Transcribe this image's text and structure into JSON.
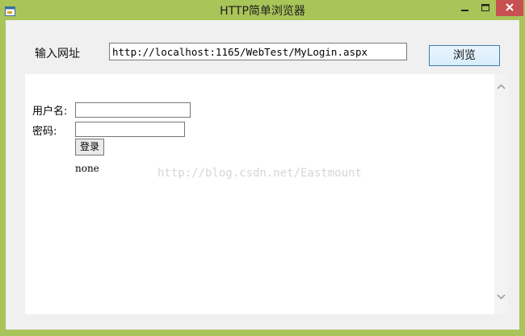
{
  "window": {
    "title": "HTTP简单浏览器"
  },
  "toolbar": {
    "url_label": "输入网址",
    "url_value": "http://localhost:1165/WebTest/MyLogin.aspx",
    "browse_label": "浏览"
  },
  "page": {
    "username_label": "用户名:",
    "password_label": "密码:",
    "username_value": "",
    "password_value": "",
    "login_label": "登录",
    "result_text": "none",
    "watermark": "http://blog.csdn.net/Eastmount"
  },
  "icons": {
    "app": "app-window-icon",
    "minimize": "minimize-icon",
    "maximize": "maximize-icon",
    "close": "close-icon",
    "scroll_up": "chevron-up-icon",
    "scroll_down": "chevron-down-icon"
  },
  "colors": {
    "frame": "#a9c458",
    "close": "#c75050",
    "client": "#f0f0f0"
  }
}
